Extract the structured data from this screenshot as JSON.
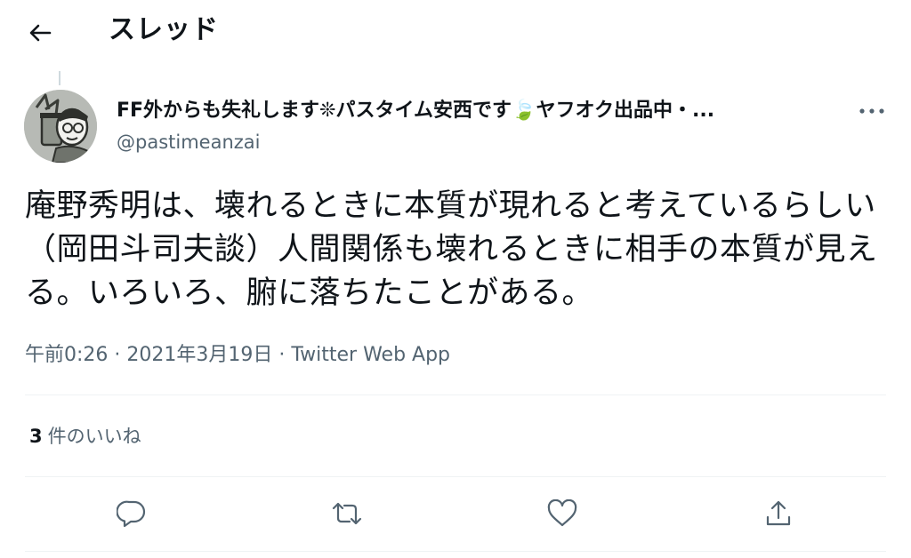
{
  "header": {
    "title": "スレッド"
  },
  "tweet": {
    "display_name": "FF外からも失礼します❊パスタイム安西です🍃ヤフオク出品中・...",
    "handle": "@pastimeanzai",
    "text": "庵野秀明は、壊れるときに本質が現れると考えているらしい（岡田斗司夫談）人間関係も壊れるときに相手の本質が見える。いろいろ、腑に落ちたことがある。",
    "meta": "午前0:26 · 2021年3月19日 · Twitter Web App",
    "likes_count": "3",
    "likes_label": "件のいいね"
  },
  "icons": {
    "back": "arrow-left-icon",
    "more": "more-horizontal-icon",
    "reply": "reply-bubble-icon",
    "retweet": "retweet-icon",
    "like": "heart-icon",
    "share": "share-icon"
  }
}
